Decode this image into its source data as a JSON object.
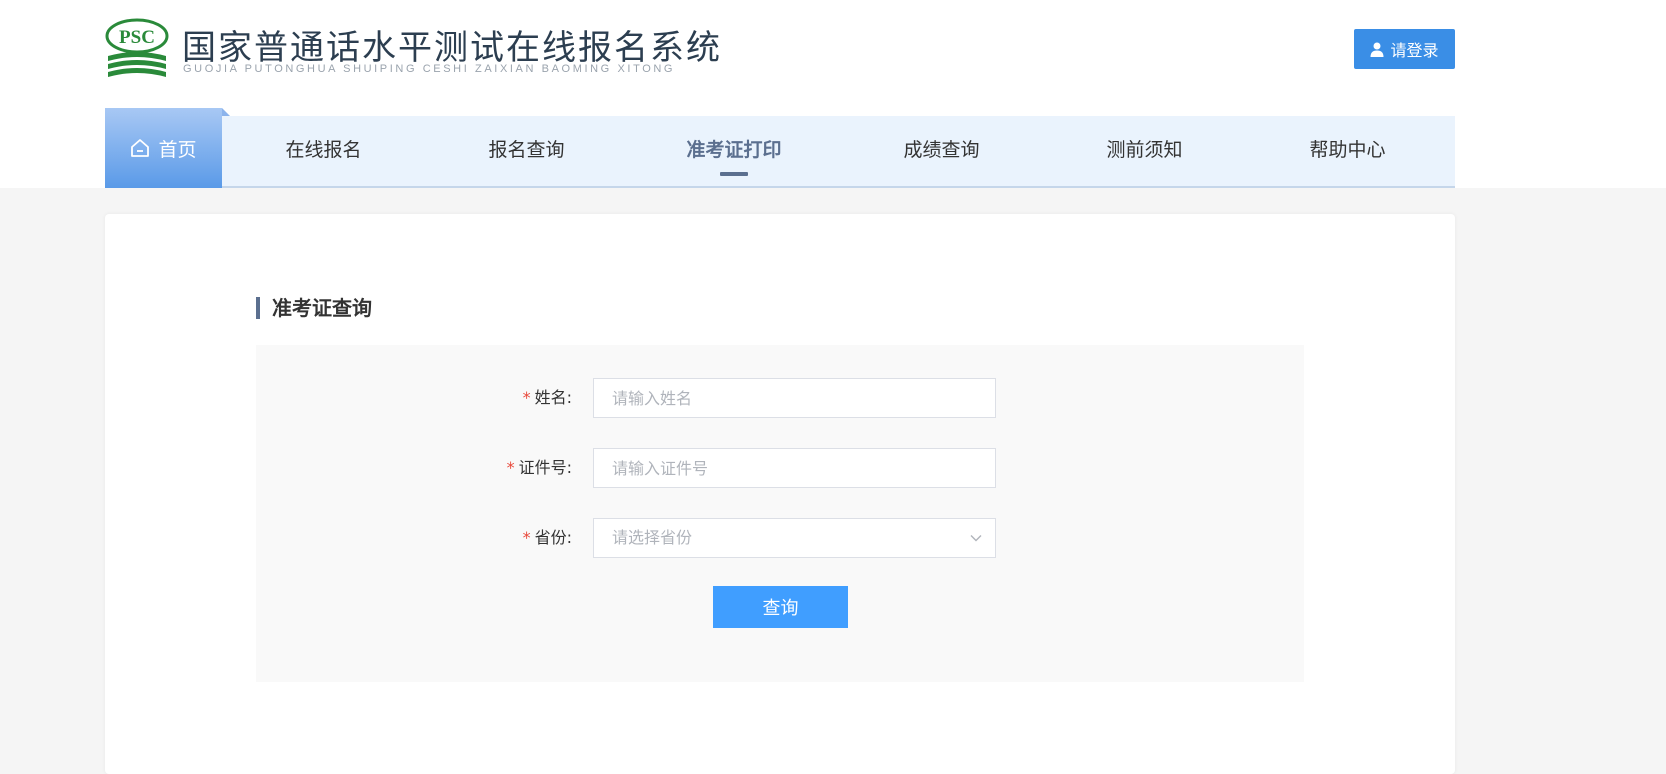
{
  "header": {
    "logo_text": "PSC",
    "title": "国家普通话水平测试在线报名系统",
    "subtitle": "GUOJIA PUTONGHUA SHUIPING CESHI ZAIXIAN BAOMING XITONG",
    "login_label": "请登录"
  },
  "nav": {
    "items": [
      {
        "label": "首页",
        "icon": "home-icon"
      },
      {
        "label": "在线报名"
      },
      {
        "label": "报名查询"
      },
      {
        "label": "准考证打印",
        "active": true
      },
      {
        "label": "成绩查询"
      },
      {
        "label": "测前须知"
      },
      {
        "label": "帮助中心"
      }
    ]
  },
  "main": {
    "section_title": "准考证查询",
    "form": {
      "required_mark": "*",
      "name_label": "姓名:",
      "name_placeholder": "请输入姓名",
      "id_label": "证件号:",
      "id_placeholder": "请输入证件号",
      "province_label": "省份:",
      "province_placeholder": "请选择省份",
      "submit_label": "查询"
    }
  },
  "colors": {
    "primary": "#409eff",
    "nav_bg": "#eaf3fd",
    "active": "#5b6f8f",
    "required": "#e8483a"
  }
}
